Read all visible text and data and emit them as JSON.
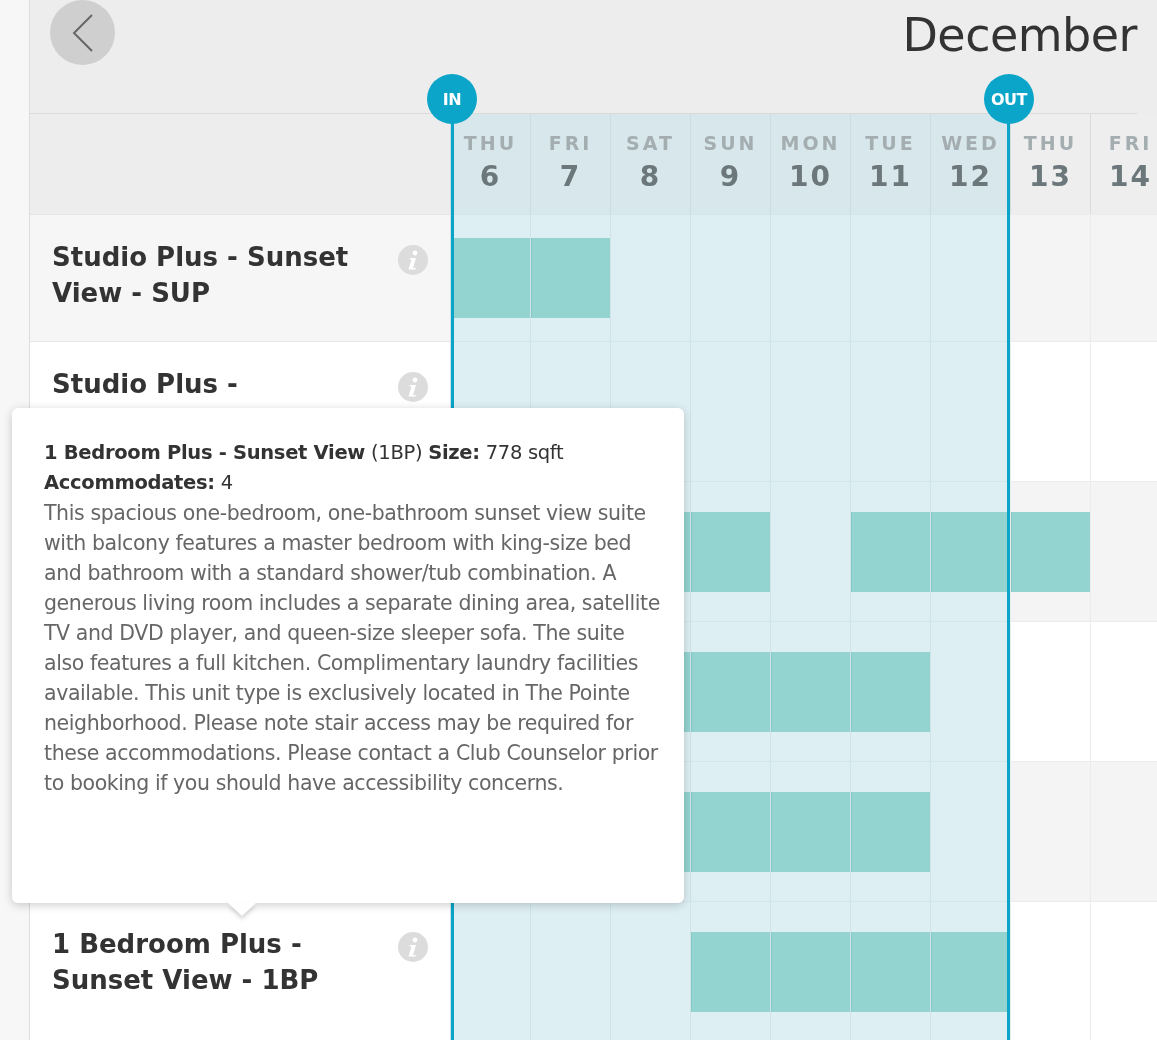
{
  "month": "December",
  "markers": {
    "check_in": "IN",
    "check_out": "OUT"
  },
  "days": [
    {
      "weekday": "THU",
      "day": "6",
      "in_stay": true
    },
    {
      "weekday": "FRI",
      "day": "7",
      "in_stay": true
    },
    {
      "weekday": "SAT",
      "day": "8",
      "in_stay": true
    },
    {
      "weekday": "SUN",
      "day": "9",
      "in_stay": true
    },
    {
      "weekday": "MON",
      "day": "10",
      "in_stay": true
    },
    {
      "weekday": "TUE",
      "day": "11",
      "in_stay": true
    },
    {
      "weekday": "WED",
      "day": "12",
      "in_stay": true
    },
    {
      "weekday": "THU",
      "day": "13",
      "in_stay": false
    },
    {
      "weekday": "FRI",
      "day": "14",
      "in_stay": false
    }
  ],
  "rows": [
    {
      "title": "Studio Plus - Sunset View - SUP",
      "cells": [
        {
          "booked": true
        },
        {
          "booked": true
        },
        {
          "booked": false
        },
        {
          "booked": false
        },
        {
          "booked": false
        },
        {
          "booked": false
        },
        {
          "booked": false
        },
        {
          "booked": false
        },
        {
          "booked": false
        }
      ]
    },
    {
      "title": "Studio Plus -",
      "cells": [
        {
          "booked": false
        },
        {
          "booked": false
        },
        {
          "booked": false
        },
        {
          "booked": false
        },
        {
          "booked": false
        },
        {
          "booked": false
        },
        {
          "booked": false
        },
        {
          "booked": false
        },
        {
          "booked": false
        }
      ]
    },
    {
      "cells": [
        {},
        {},
        {
          "booked": true
        },
        {
          "booked": true
        },
        {
          "booked": false
        },
        {
          "booked": true
        },
        {
          "booked": true
        },
        {
          "booked": true
        },
        {
          "booked": false
        }
      ]
    },
    {
      "cells": [
        {},
        {},
        {
          "booked": true
        },
        {
          "booked": true
        },
        {
          "booked": true
        },
        {
          "booked": true
        },
        {
          "booked": false
        },
        {
          "booked": false
        },
        {
          "booked": false
        }
      ]
    },
    {
      "cells": [
        {},
        {},
        {
          "booked": true
        },
        {
          "booked": true
        },
        {
          "booked": true
        },
        {
          "booked": true
        },
        {
          "booked": false
        },
        {
          "booked": false
        },
        {
          "booked": false
        }
      ]
    },
    {
      "title": "1 Bedroom Plus - Sunset View - 1BP",
      "cells": [
        {
          "booked": false
        },
        {
          "booked": false
        },
        {
          "booked": false
        },
        {
          "booked": true
        },
        {
          "booked": true
        },
        {
          "booked": true
        },
        {
          "booked": true
        },
        {
          "booked": false
        },
        {
          "booked": false
        }
      ]
    }
  ],
  "tooltip": {
    "heading": "**1 Bedroom Plus - Sunset View** (1BP) **Size:** 778 sqft **Accommodates:** 4",
    "description": "This spacious one-bedroom, one-bathroom sunset view suite with balcony features a master bedroom with king-size bed and bathroom with a standard shower/tub combination. A generous living room includes a separate dining area, satellite TV and DVD player, and queen-size sleeper sofa. The suite also features a full kitchen. Complimentary laundry facilities available. This unit type is exclusively located in The Pointe neighborhood. Please note stair access may be required for these accommodations. Please contact a Club Counselor prior to booking if you should have accessibility concerns."
  }
}
